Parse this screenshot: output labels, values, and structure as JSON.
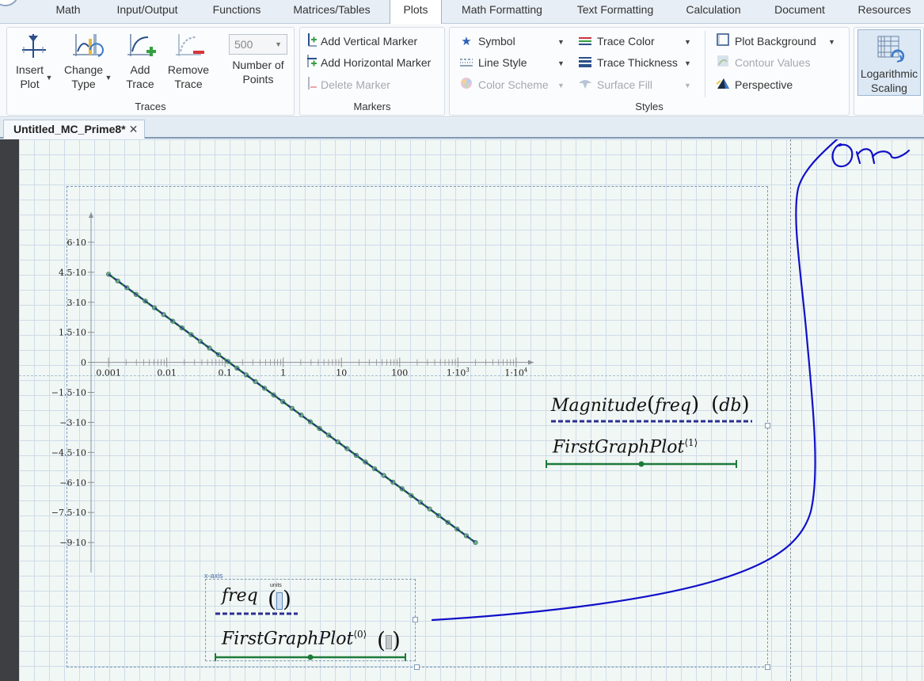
{
  "ribbon_tabs": [
    "Math",
    "Input/Output",
    "Functions",
    "Matrices/Tables",
    "Plots",
    "Math Formatting",
    "Text Formatting",
    "Calculation",
    "Document",
    "Resources"
  ],
  "active_tab": "Plots",
  "groups": {
    "traces": {
      "label": "Traces",
      "insert_plot": "Insert Plot",
      "change_type": "Change Type",
      "add_trace": "Add Trace",
      "remove_trace": "Remove Trace",
      "num_points_value": "500",
      "num_points_label": "Number of Points"
    },
    "markers": {
      "label": "Markers",
      "add_vertical": "Add Vertical Marker",
      "add_horizontal": "Add Horizontal Marker",
      "delete_marker": "Delete Marker"
    },
    "styles": {
      "label": "Styles",
      "symbol": "Symbol",
      "line_style": "Line Style",
      "color_scheme": "Color Scheme",
      "trace_color": "Trace Color",
      "trace_thickness": "Trace Thickness",
      "surface_fill": "Surface Fill",
      "plot_background": "Plot Background",
      "contour_values": "Contour Values",
      "perspective": "Perspective"
    },
    "log_scaling": "Logarithmic Scaling"
  },
  "document_tab": "Untitled_MC_Prime8*",
  "plot": {
    "y_ticks": [
      "6·10",
      "4.5·10",
      "3·10",
      "1.5·10",
      "0",
      "−1.5·10",
      "−3·10",
      "−4.5·10",
      "−6·10",
      "−7.5·10",
      "−9·10"
    ],
    "x_ticks": [
      "0.001",
      "0.01",
      "0.1",
      "1",
      "10",
      "100",
      "1·10",
      "1·10"
    ],
    "x_tick_sups": [
      "3",
      "4"
    ],
    "y_expr_main": "Magnitude",
    "y_expr_arg": "freq",
    "y_expr_unit": "db",
    "y_expr2": "FirstGraphPlot",
    "y_expr2_sup": "⟨1⟩",
    "x_axis_tag": "x-axis",
    "units_tag": "units",
    "x_expr1": "freq",
    "x_expr2": "FirstGraphPlot",
    "x_expr2_sup": "⟨0⟩"
  },
  "chart_data": {
    "type": "line",
    "x_scale": "log",
    "x": [
      0.001,
      2000
    ],
    "y": [
      4.4,
      -9.0
    ],
    "xlim": [
      0.0005,
      20000
    ],
    "ylim": [
      -10.5,
      7.5
    ],
    "series": [
      {
        "name": "Magnitude(freq) (db)",
        "style": "dashed",
        "color": "#2b2f8f"
      },
      {
        "name": "FirstGraphPlot⟨1⟩",
        "style": "solid-dots",
        "color": "#1e7a3a"
      }
    ]
  },
  "annotation": {
    "handwritten_text": "On",
    "color": "#1010c8"
  }
}
